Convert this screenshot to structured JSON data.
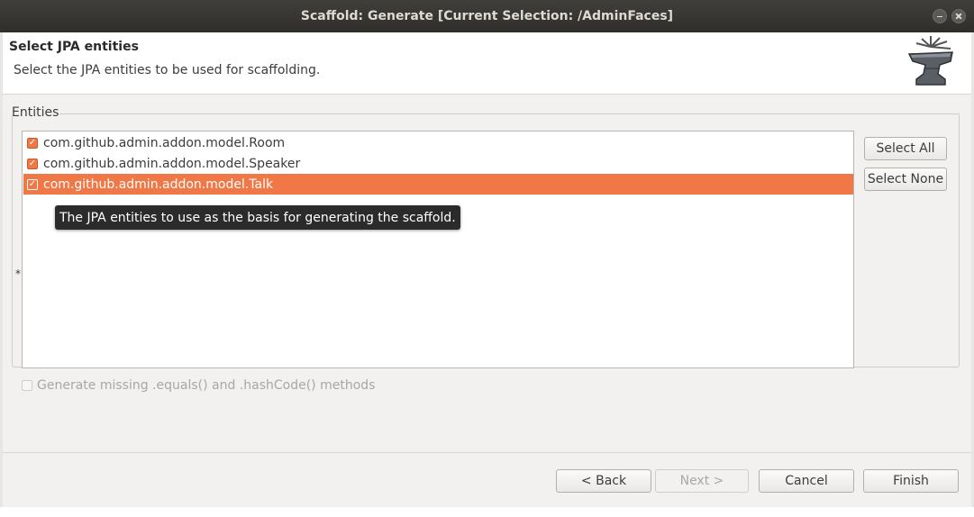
{
  "window": {
    "title": "Scaffold: Generate [Current Selection: /AdminFaces]"
  },
  "header": {
    "title": "Select JPA entities",
    "description": "Select the JPA entities to be used for scaffolding.",
    "icon": "anvil-icon"
  },
  "entities": {
    "group_label": "Entities",
    "required_marker": "*",
    "items": [
      {
        "label": "com.github.admin.addon.model.Room",
        "checked": true,
        "selected": false
      },
      {
        "label": "com.github.admin.addon.model.Speaker",
        "checked": true,
        "selected": false
      },
      {
        "label": "com.github.admin.addon.model.Talk",
        "checked": true,
        "selected": true
      }
    ],
    "tooltip": "The JPA entities to use as the basis for generating the scaffold.",
    "select_all_label": "Select All",
    "select_none_label": "Select None"
  },
  "options": {
    "generate_methods_label": "Generate missing .equals() and .hashCode() methods",
    "generate_methods_checked": false,
    "generate_methods_enabled": false
  },
  "footer": {
    "back_label": "< Back",
    "next_label": "Next >",
    "cancel_label": "Cancel",
    "finish_label": "Finish"
  },
  "colors": {
    "accent": "#f07746",
    "titlebar": "#3a3936",
    "tooltip_bg": "#2b2b2b"
  }
}
